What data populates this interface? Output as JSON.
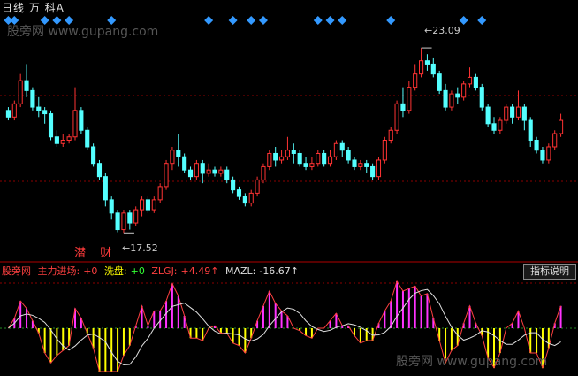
{
  "header": {
    "title": "日线 万 科A"
  },
  "watermark": {
    "top": "股旁网 www.gupang.com",
    "bottom": "股旁网 www.gupang.com"
  },
  "price_annotations": {
    "high": "←23.09",
    "low": "←17.52"
  },
  "stamp": {
    "text": "潜 财"
  },
  "indicator": {
    "source": "股旁网",
    "main_force_label": "主力进场:",
    "main_force_value": "+0",
    "wash_label": "洗盘:",
    "wash_value": "+0",
    "zlgj_label": "ZLGJ:",
    "zlgj_value": "+4.49↑",
    "mazl_label": "MAZL:",
    "mazl_value": "-16.67↑",
    "help_button": "指标说明"
  },
  "colors": {
    "background": "#000000",
    "up": "#ff3333",
    "down": "#54ffff",
    "diamond": "#3399ff",
    "grid": "#8b0000",
    "zlgj_text": "#ff4040",
    "mazl_text": "#e0e0e0",
    "wash_text": "#33ff33",
    "magenta": "#ff33ff",
    "yellow": "#ffff00"
  },
  "chart_data": {
    "type": "candlestick",
    "y_range": [
      17.0,
      23.6
    ],
    "candles": [
      [
        21.2,
        21.0,
        21.3,
        20.9
      ],
      [
        21.0,
        21.4,
        21.5,
        20.9
      ],
      [
        21.4,
        22.1,
        22.3,
        21.3
      ],
      [
        22.1,
        21.8,
        22.6,
        21.6
      ],
      [
        21.8,
        21.3,
        21.9,
        21.2
      ],
      [
        21.3,
        21.2,
        21.6,
        21.0
      ],
      [
        21.2,
        21.1,
        21.3,
        20.8
      ],
      [
        21.1,
        20.4,
        21.2,
        20.3
      ],
      [
        20.4,
        20.2,
        20.6,
        20.1
      ],
      [
        20.2,
        20.3,
        20.5,
        20.1
      ],
      [
        20.3,
        20.4,
        20.5,
        20.2
      ],
      [
        20.4,
        21.2,
        21.9,
        20.3
      ],
      [
        21.2,
        20.6,
        21.3,
        20.5
      ],
      [
        20.6,
        20.1,
        20.7,
        20.0
      ],
      [
        20.1,
        19.6,
        20.2,
        19.5
      ],
      [
        19.6,
        19.2,
        19.7,
        19.1
      ],
      [
        19.2,
        18.5,
        19.3,
        18.3
      ],
      [
        18.5,
        18.1,
        18.6,
        17.9
      ],
      [
        18.1,
        17.6,
        18.2,
        17.52
      ],
      [
        17.6,
        18.1,
        18.2,
        17.5
      ],
      [
        18.1,
        17.8,
        18.2,
        17.6
      ],
      [
        17.8,
        18.2,
        18.3,
        17.7
      ],
      [
        18.2,
        18.5,
        18.6,
        18.0
      ],
      [
        18.5,
        18.2,
        18.6,
        18.1
      ],
      [
        18.2,
        18.5,
        18.6,
        18.1
      ],
      [
        18.5,
        18.9,
        19.0,
        18.4
      ],
      [
        18.9,
        19.6,
        19.7,
        18.8
      ],
      [
        19.6,
        20.0,
        20.1,
        19.4
      ],
      [
        20.0,
        19.8,
        20.5,
        19.5
      ],
      [
        19.8,
        19.4,
        19.9,
        19.3
      ],
      [
        19.4,
        19.2,
        19.5,
        19.1
      ],
      [
        19.2,
        19.6,
        19.7,
        19.1
      ],
      [
        19.6,
        19.3,
        19.7,
        19.0
      ],
      [
        19.3,
        19.4,
        19.6,
        19.2
      ],
      [
        19.4,
        19.3,
        19.5,
        19.2
      ],
      [
        19.3,
        19.4,
        19.5,
        19.2
      ],
      [
        19.4,
        19.1,
        19.5,
        19.0
      ],
      [
        19.1,
        18.8,
        19.2,
        18.7
      ],
      [
        18.8,
        18.6,
        18.9,
        18.5
      ],
      [
        18.6,
        18.4,
        18.7,
        18.3
      ],
      [
        18.4,
        18.7,
        18.8,
        18.3
      ],
      [
        18.7,
        19.1,
        19.2,
        18.6
      ],
      [
        19.1,
        19.5,
        19.6,
        19.0
      ],
      [
        19.5,
        19.9,
        20.0,
        19.4
      ],
      [
        19.9,
        19.7,
        20.1,
        19.5
      ],
      [
        19.7,
        19.8,
        20.0,
        19.6
      ],
      [
        19.8,
        20.0,
        20.4,
        19.7
      ],
      [
        20.0,
        19.9,
        20.2,
        19.6
      ],
      [
        19.9,
        19.6,
        20.0,
        19.5
      ],
      [
        19.6,
        19.5,
        19.8,
        19.4
      ],
      [
        19.5,
        19.6,
        19.8,
        19.4
      ],
      [
        19.6,
        19.9,
        20.0,
        19.5
      ],
      [
        19.9,
        19.6,
        20.0,
        19.5
      ],
      [
        19.6,
        19.8,
        20.0,
        19.5
      ],
      [
        19.8,
        20.2,
        20.3,
        19.7
      ],
      [
        20.2,
        20.0,
        20.3,
        19.8
      ],
      [
        20.0,
        19.7,
        20.1,
        19.6
      ],
      [
        19.7,
        19.5,
        19.8,
        19.4
      ],
      [
        19.5,
        19.6,
        19.7,
        19.4
      ],
      [
        19.6,
        19.5,
        19.7,
        19.3
      ],
      [
        19.5,
        19.2,
        19.6,
        19.1
      ],
      [
        19.2,
        19.7,
        19.8,
        19.1
      ],
      [
        19.7,
        20.3,
        20.4,
        19.6
      ],
      [
        20.3,
        20.6,
        20.7,
        20.2
      ],
      [
        20.6,
        21.4,
        21.5,
        20.5
      ],
      [
        21.4,
        21.2,
        21.9,
        21.0
      ],
      [
        21.2,
        21.9,
        22.1,
        21.1
      ],
      [
        21.9,
        22.3,
        22.6,
        21.8
      ],
      [
        22.3,
        22.7,
        23.09,
        22.2
      ],
      [
        22.7,
        22.6,
        22.9,
        22.4
      ],
      [
        22.6,
        22.3,
        22.8,
        22.2
      ],
      [
        22.3,
        21.8,
        22.4,
        21.7
      ],
      [
        21.8,
        21.3,
        22.0,
        21.2
      ],
      [
        21.3,
        21.7,
        21.8,
        21.2
      ],
      [
        21.7,
        21.6,
        21.9,
        21.4
      ],
      [
        21.6,
        22.0,
        22.1,
        21.5
      ],
      [
        22.0,
        22.2,
        22.5,
        21.9
      ],
      [
        22.2,
        21.9,
        22.3,
        21.8
      ],
      [
        21.9,
        21.3,
        22.0,
        21.2
      ],
      [
        21.3,
        20.8,
        21.4,
        20.7
      ],
      [
        20.8,
        20.6,
        21.0,
        20.5
      ],
      [
        20.6,
        20.9,
        21.0,
        20.5
      ],
      [
        20.9,
        21.3,
        21.4,
        20.8
      ],
      [
        21.3,
        21.0,
        21.4,
        20.8
      ],
      [
        21.0,
        21.3,
        21.8,
        20.9
      ],
      [
        21.3,
        20.9,
        21.4,
        20.6
      ],
      [
        20.9,
        20.3,
        21.0,
        20.1
      ],
      [
        20.3,
        20.0,
        20.4,
        19.9
      ],
      [
        20.0,
        19.7,
        20.1,
        19.6
      ],
      [
        19.7,
        20.1,
        20.2,
        19.6
      ],
      [
        20.1,
        20.5,
        20.6,
        20.0
      ],
      [
        20.5,
        20.9,
        21.1,
        20.4
      ]
    ],
    "signal_diamonds": [
      0,
      1,
      6,
      8,
      10,
      17,
      33,
      37,
      40,
      42,
      51,
      53,
      55,
      63,
      75,
      78
    ]
  }
}
